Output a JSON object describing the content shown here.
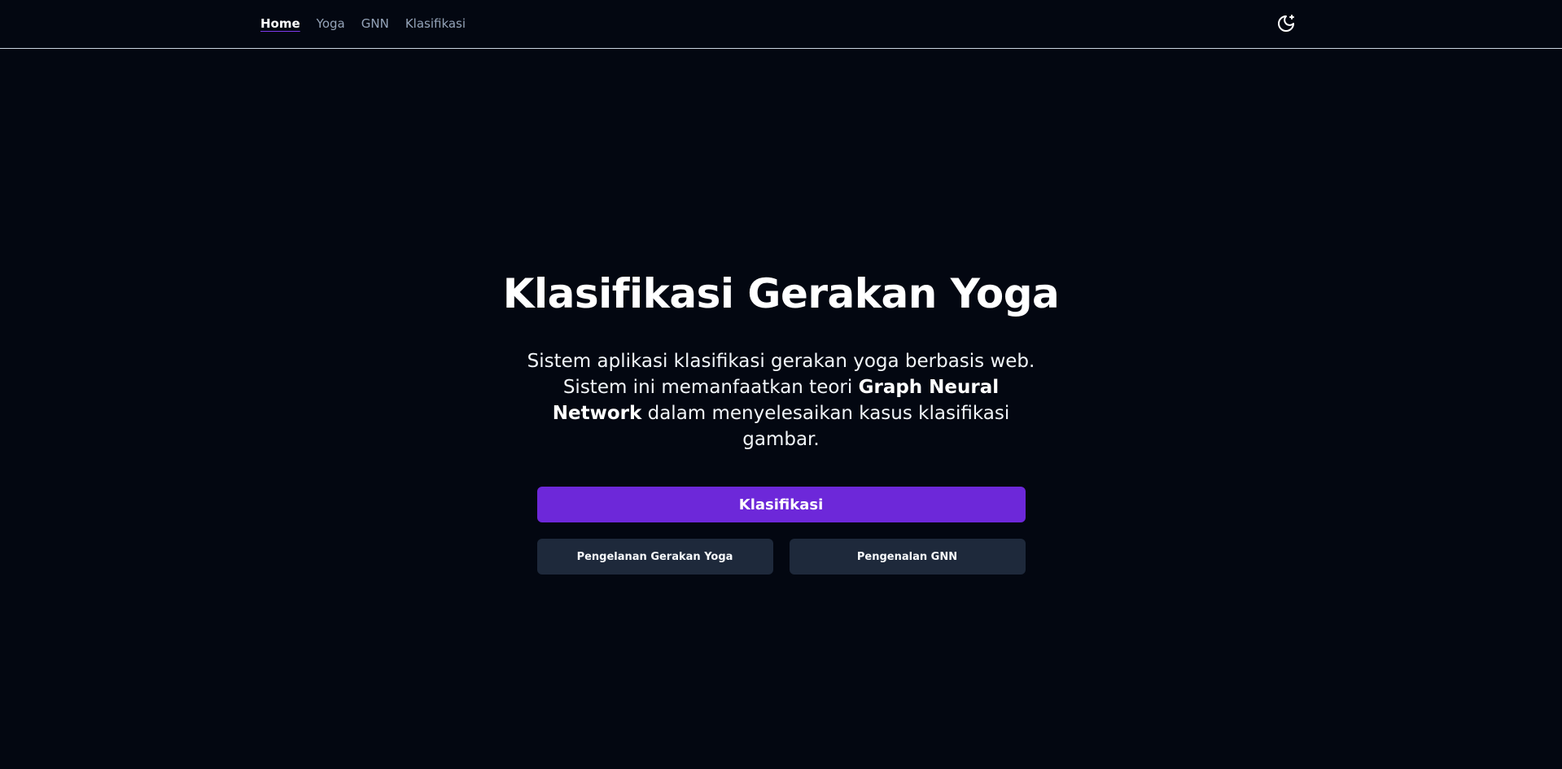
{
  "nav": {
    "items": [
      {
        "label": "Home",
        "active": true
      },
      {
        "label": "Yoga",
        "active": false
      },
      {
        "label": "GNN",
        "active": false
      },
      {
        "label": "Klasifikasi",
        "active": false
      }
    ],
    "theme_toggle_icon": "moon-sparkle-icon"
  },
  "hero": {
    "title": "Klasifikasi Gerakan Yoga",
    "desc_part1": "Sistem aplikasi klasifikasi gerakan yoga berbasis web. Sistem ini memanfaatkan teori ",
    "desc_bold": "Graph Neural Network",
    "desc_part2": " dalam menyelesaikan kasus klasifikasi gambar.",
    "primary_button": "Klasifikasi",
    "secondary_buttons": [
      "Pengelanan Gerakan Yoga",
      "Pengenalan GNN"
    ]
  },
  "colors": {
    "background": "#030711",
    "accent": "#6d28d9",
    "secondary_button": "#1e293b",
    "nav_inactive": "#94a3b8"
  }
}
